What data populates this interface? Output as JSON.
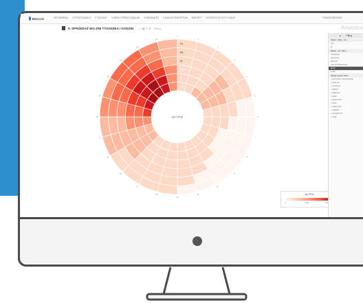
{
  "app": {
    "brand": "BROCCE",
    "menu": [
      "ZESTAWIENIA",
      "S PROSTŁUMACZ",
      "F FAKTURY",
      "S-WEEK OPERACJONALNE",
      "S WEWNĄTRZ",
      "Z ANALIZY RAPORTÓW",
      "RAPORTY",
      "DYSPOZYCJE DOTYCZĄCE"
    ],
    "user": "TOMASZ BROWSKI",
    "product": "Analytics"
  },
  "report": {
    "title": "9. SPRZEDAŻ WG DNI TYGODNIA I GODZIN",
    "tool_label": "Filtruj"
  },
  "side_panel": {
    "header": "Filtruj",
    "items": [
      {
        "kind": "section",
        "label": "Data 9 - Miss : Ca..."
      },
      {
        "kind": "line",
        "label": "9 M"
      },
      {
        "kind": "line",
        "label": "M"
      },
      {
        "kind": "section",
        "label": "Miasto - All - Miss..."
      },
      {
        "kind": "line",
        "label": "Lokalizacja"
      },
      {
        "kind": "line",
        "label": "Warszawa"
      },
      {
        "kind": "line",
        "label": "Białystok"
      },
      {
        "kind": "line",
        "label": "Gorzów Wielkopolski"
      },
      {
        "kind": "selected",
        "label": "Filtruj"
      },
      {
        "kind": "line",
        "label": "Lublin"
      },
      {
        "kind": "section",
        "label": "Kategoryzacja Towa..."
      },
      {
        "kind": "line",
        "label": "+ ARTYKUŁY SPOŻYWCZE"
      },
      {
        "kind": "line",
        "label": "+ NAPOJE"
      },
      {
        "kind": "line",
        "label": "+ ALKOHOL"
      },
      {
        "kind": "line",
        "label": "+ MIĘSO"
      },
      {
        "kind": "line",
        "label": "+ WĘDLINY"
      },
      {
        "kind": "line",
        "label": "+ SERY"
      },
      {
        "kind": "line",
        "label": "+ PIECZYWO"
      },
      {
        "kind": "line",
        "label": "+ RYBY"
      },
      {
        "kind": "line",
        "label": "+ WARZYWA"
      },
      {
        "kind": "line",
        "label": "+ CHEMIA"
      },
      {
        "kind": "line",
        "label": "+ KOSMETYKI"
      },
      {
        "kind": "line",
        "label": "+ INNE"
      }
    ]
  },
  "chart_data": {
    "type": "heatmap",
    "layout": "radial",
    "center_label": "szt / PLN",
    "days": [
      "Sob",
      "Pt",
      "Czw",
      "Śr",
      "Wt",
      "Pn"
    ],
    "hours": [
      "0",
      "1",
      "2",
      "3",
      "4",
      "5",
      "6",
      "7",
      "8",
      "9",
      "10",
      "11",
      "12",
      "13",
      "14",
      "15",
      "16",
      "17",
      "18",
      "19",
      "20",
      "21",
      "22",
      "23"
    ],
    "legend": {
      "title": "szt / PLN",
      "low": "0",
      "mid": "1 000",
      "high": "2 000"
    },
    "colors": [
      "#fff5f0",
      "#fdd9c7",
      "#fcbba1",
      "#fc9272",
      "#fb6a4a",
      "#ef3b2c",
      "#cb181d",
      "#a50f15"
    ],
    "values": [
      [
        1,
        1,
        2,
        2,
        2,
        1,
        1,
        1,
        1,
        1,
        1,
        1,
        1,
        1,
        1,
        2,
        2,
        3,
        5,
        6,
        7,
        7,
        6,
        3
      ],
      [
        1,
        1,
        1,
        2,
        2,
        1,
        1,
        1,
        1,
        1,
        1,
        1,
        1,
        1,
        1,
        2,
        2,
        3,
        4,
        5,
        6,
        7,
        6,
        3
      ],
      [
        1,
        1,
        1,
        2,
        2,
        1,
        1,
        0,
        0,
        1,
        1,
        1,
        1,
        1,
        1,
        2,
        2,
        3,
        4,
        5,
        6,
        6,
        5,
        3
      ],
      [
        1,
        1,
        1,
        2,
        1,
        1,
        0,
        0,
        0,
        0,
        1,
        1,
        1,
        1,
        1,
        2,
        2,
        2,
        3,
        4,
        5,
        5,
        4,
        2
      ],
      [
        1,
        1,
        1,
        1,
        1,
        0,
        0,
        0,
        0,
        0,
        0,
        1,
        1,
        1,
        1,
        1,
        2,
        2,
        3,
        4,
        4,
        4,
        3,
        2
      ],
      [
        1,
        1,
        1,
        1,
        1,
        0,
        0,
        0,
        0,
        0,
        0,
        0,
        1,
        1,
        1,
        1,
        2,
        2,
        3,
        3,
        4,
        4,
        3,
        2
      ]
    ]
  }
}
